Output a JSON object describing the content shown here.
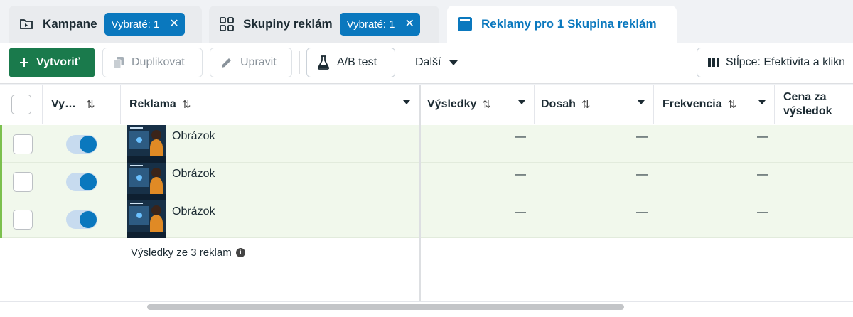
{
  "tabs": [
    {
      "label": "Kampane",
      "badge": "Vybraté: 1",
      "icon": "folder-icon"
    },
    {
      "label": "Skupiny reklám",
      "badge": "Vybraté: 1",
      "icon": "grid-icon"
    },
    {
      "label": "Reklamy pro 1 Skupina reklám",
      "icon": "ad-window-icon"
    }
  ],
  "toolbar": {
    "create_label": "Vytvoriť",
    "duplicate_label": "Duplikovat",
    "edit_label": "Upravit",
    "ab_test_label": "A/B test",
    "more_label": "Další",
    "columns_label": "Stĺpce: Efektivita a klikn"
  },
  "columns": {
    "toggle": "Vy…",
    "ad": "Reklama",
    "results": "Výsledky",
    "reach": "Dosah",
    "frequency": "Frekvencia",
    "cost_line1": "Cena za",
    "cost_line2": "výsledok"
  },
  "rows": [
    {
      "name": "Obrázok",
      "on": true,
      "results": "—",
      "reach": "—",
      "frequency": "—"
    },
    {
      "name": "Obrázok",
      "on": true,
      "results": "—",
      "reach": "—",
      "frequency": "—"
    },
    {
      "name": "Obrázok",
      "on": true,
      "results": "—",
      "reach": "—",
      "frequency": "—"
    }
  ],
  "summary": "Výsledky ze 3 reklam",
  "colors": {
    "accent": "#0a78be",
    "create_green": "#1a7a4c",
    "row_highlight": "#f1f8ec",
    "selected_bar": "#7cc04e"
  }
}
